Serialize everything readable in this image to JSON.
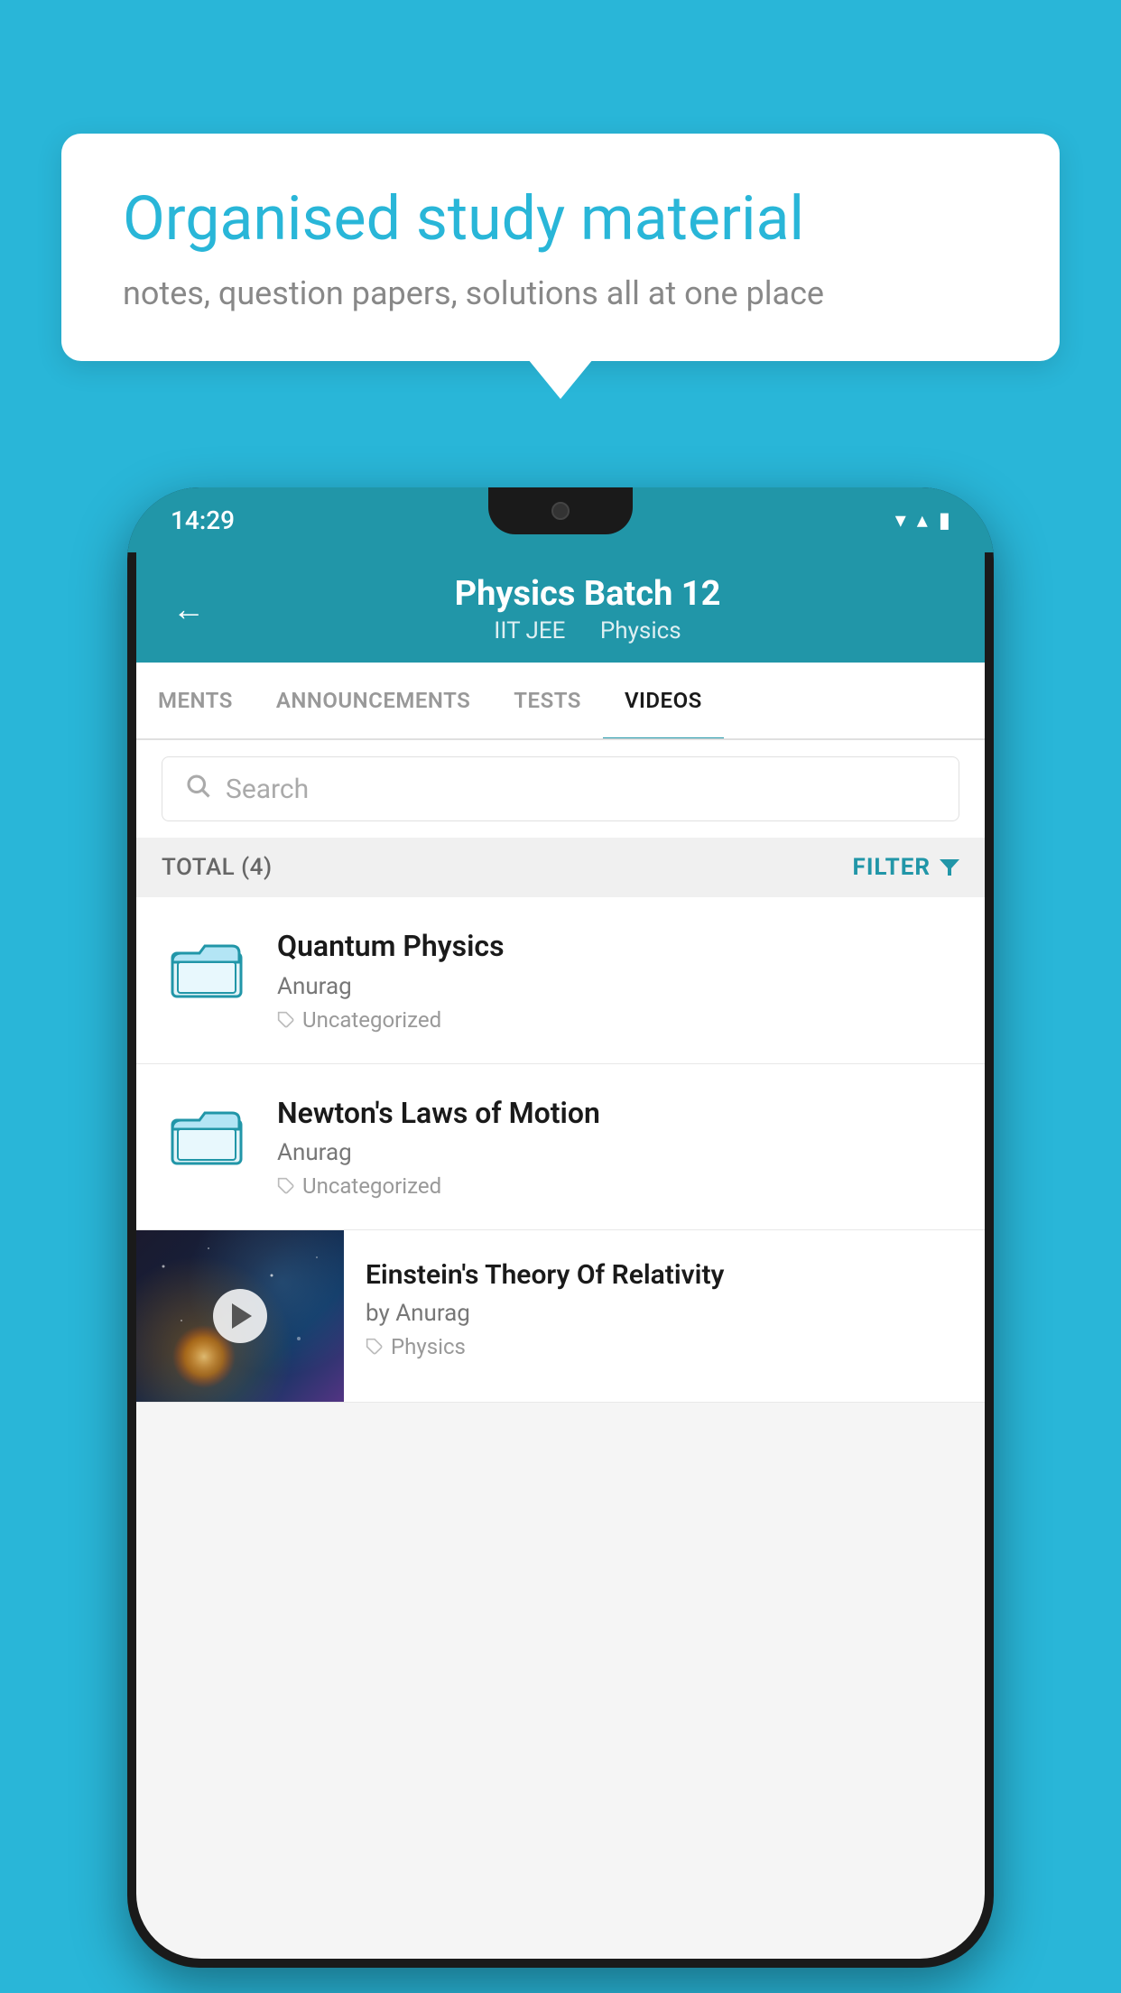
{
  "background_color": "#29b6d8",
  "bubble": {
    "title": "Organised study material",
    "subtitle": "notes, question papers, solutions all at one place"
  },
  "status_bar": {
    "time": "14:29",
    "wifi_icon": "▼",
    "signal_icon": "▲",
    "battery_icon": "▮"
  },
  "header": {
    "title": "Physics Batch 12",
    "subtitle_part1": "IIT JEE",
    "subtitle_part2": "Physics",
    "back_label": "←"
  },
  "tabs": [
    {
      "label": "MENTS",
      "active": false
    },
    {
      "label": "ANNOUNCEMENTS",
      "active": false
    },
    {
      "label": "TESTS",
      "active": false
    },
    {
      "label": "VIDEOS",
      "active": true
    }
  ],
  "search": {
    "placeholder": "Search"
  },
  "filter_row": {
    "total_label": "TOTAL (4)",
    "filter_label": "FILTER"
  },
  "videos": [
    {
      "id": 1,
      "title": "Quantum Physics",
      "author": "Anurag",
      "tag": "Uncategorized",
      "has_thumbnail": false
    },
    {
      "id": 2,
      "title": "Newton's Laws of Motion",
      "author": "Anurag",
      "tag": "Uncategorized",
      "has_thumbnail": false
    },
    {
      "id": 3,
      "title": "Einstein's Theory Of Relativity",
      "author": "by Anurag",
      "tag": "Physics",
      "has_thumbnail": true
    }
  ]
}
